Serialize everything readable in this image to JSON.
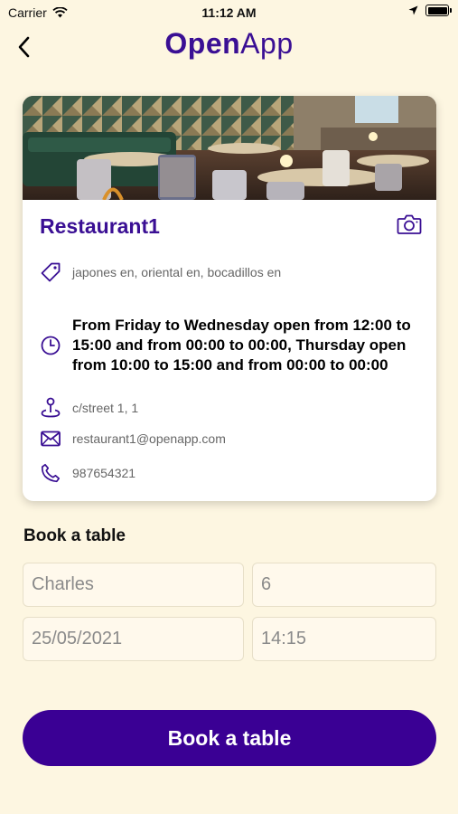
{
  "status_bar": {
    "carrier": "Carrier",
    "time": "11:12 AM"
  },
  "nav": {
    "brand_part1": "Open",
    "brand_part2": "App"
  },
  "restaurant": {
    "name": "Restaurant1",
    "tags": "japones en, oriental en, bocadillos en",
    "hours": "From Friday to Wednesday open from 12:00 to 15:00 and from 00:00 to 00:00, Thursday open from 10:00 to 15:00 and from 00:00 to 00:00",
    "address": "c/street 1, 1",
    "email": "restaurant1@openapp.com",
    "phone": "987654321"
  },
  "booking": {
    "title": "Book a table",
    "name_value": "Charles",
    "people_value": "6",
    "date_value": "25/05/2021",
    "time_value": "14:15",
    "button_label": "Book a table"
  },
  "colors": {
    "accent": "#3A0F94",
    "button": "#3A0094",
    "background": "#FDF6E1"
  }
}
